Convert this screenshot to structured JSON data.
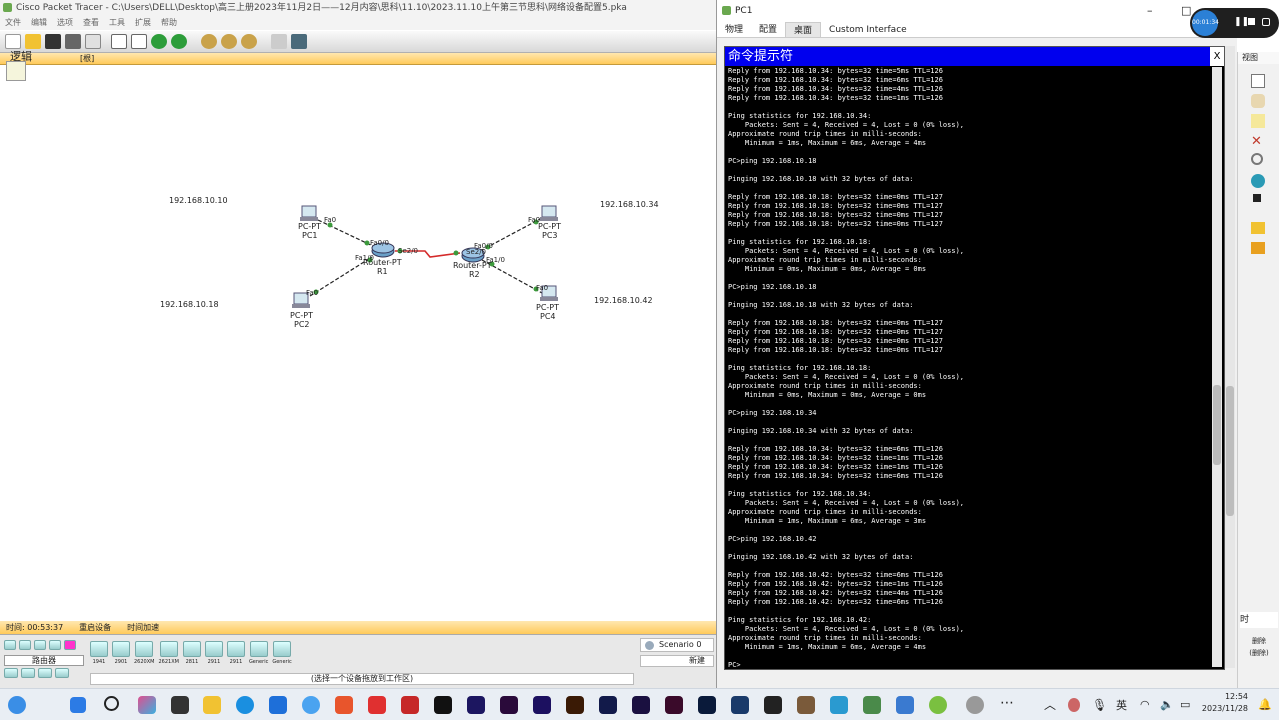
{
  "pt": {
    "title": "Cisco Packet Tracer - C:\\Users\\DELL\\Desktop\\高三上册2023年11月2日——12月内容\\思科\\11.10\\2023.11.10上午第三节思科\\网络设备配置5.pka",
    "menu": [
      "文件",
      "编辑",
      "选项",
      "查看",
      "工具",
      "扩展",
      "帮助"
    ],
    "ws_label": "逻辑",
    "ws_root": "[根]",
    "ip_labels": [
      "192.168.10.10",
      "192.168.10.18",
      "192.168.10.34",
      "192.168.10.42"
    ],
    "devices": [
      {
        "type": "PC-PT",
        "name": "PC1",
        "port": "Fa0"
      },
      {
        "type": "PC-PT",
        "name": "PC2",
        "port": "Fa0"
      },
      {
        "type": "PC-PT",
        "name": "PC3",
        "port": "Fa0"
      },
      {
        "type": "PC-PT",
        "name": "PC4",
        "port": "Fa0"
      },
      {
        "type": "Router-PT",
        "name": "R1"
      },
      {
        "type": "Router-PT",
        "name": "R2"
      }
    ],
    "r1_ports": [
      "Fa0/0",
      "Fa1/0",
      "Se2/0"
    ],
    "r2_ports": [
      "Fa0/0",
      "Fa1/0",
      "Se2/0"
    ],
    "status": {
      "time": "时间: 00:53:37",
      "power": "重启设备",
      "fast": "时间加速"
    },
    "category": "路由器",
    "models": [
      "1941",
      "2901",
      "2620XM",
      "2621XM",
      "2811",
      "2911",
      "2911",
      "Generic",
      "Generic"
    ],
    "hint": "(选择一个设备拖放到工作区)",
    "scenario": "Scenario 0",
    "new_btn": "新建",
    "delete_btn": "删除",
    "delete_btn2": "(删除)"
  },
  "pc1": {
    "title": "PC1",
    "tabs": [
      "物理",
      "配置",
      "桌面",
      "Custom Interface"
    ],
    "active_tab": 2,
    "cmd_title": "命令提示符",
    "close": "X",
    "lines": [
      "Reply from 192.168.10.34: bytes=32 time=5ms TTL=126",
      "Reply from 192.168.10.34: bytes=32 time=6ms TTL=126",
      "Reply from 192.168.10.34: bytes=32 time=4ms TTL=126",
      "Reply from 192.168.10.34: bytes=32 time=1ms TTL=126",
      "",
      "Ping statistics for 192.168.10.34:",
      "    Packets: Sent = 4, Received = 4, Lost = 0 (0% loss),",
      "Approximate round trip times in milli-seconds:",
      "    Minimum = 1ms, Maximum = 6ms, Average = 4ms",
      "",
      "PC>ping 192.168.10.18",
      "",
      "Pinging 192.168.10.18 with 32 bytes of data:",
      "",
      "Reply from 192.168.10.18: bytes=32 time=0ms TTL=127",
      "Reply from 192.168.10.18: bytes=32 time=0ms TTL=127",
      "Reply from 192.168.10.18: bytes=32 time=0ms TTL=127",
      "Reply from 192.168.10.18: bytes=32 time=0ms TTL=127",
      "",
      "Ping statistics for 192.168.10.18:",
      "    Packets: Sent = 4, Received = 4, Lost = 0 (0% loss),",
      "Approximate round trip times in milli-seconds:",
      "    Minimum = 0ms, Maximum = 0ms, Average = 0ms",
      "",
      "PC>ping 192.168.10.18",
      "",
      "Pinging 192.168.10.18 with 32 bytes of data:",
      "",
      "Reply from 192.168.10.18: bytes=32 time=0ms TTL=127",
      "Reply from 192.168.10.18: bytes=32 time=0ms TTL=127",
      "Reply from 192.168.10.18: bytes=32 time=0ms TTL=127",
      "Reply from 192.168.10.18: bytes=32 time=0ms TTL=127",
      "",
      "Ping statistics for 192.168.10.18:",
      "    Packets: Sent = 4, Received = 4, Lost = 0 (0% loss),",
      "Approximate round trip times in milli-seconds:",
      "    Minimum = 0ms, Maximum = 0ms, Average = 0ms",
      "",
      "PC>ping 192.168.10.34",
      "",
      "Pinging 192.168.10.34 with 32 bytes of data:",
      "",
      "Reply from 192.168.10.34: bytes=32 time=6ms TTL=126",
      "Reply from 192.168.10.34: bytes=32 time=1ms TTL=126",
      "Reply from 192.168.10.34: bytes=32 time=1ms TTL=126",
      "Reply from 192.168.10.34: bytes=32 time=6ms TTL=126",
      "",
      "Ping statistics for 192.168.10.34:",
      "    Packets: Sent = 4, Received = 4, Lost = 0 (0% loss),",
      "Approximate round trip times in milli-seconds:",
      "    Minimum = 1ms, Maximum = 6ms, Average = 3ms",
      "",
      "PC>ping 192.168.10.42",
      "",
      "Pinging 192.168.10.42 with 32 bytes of data:",
      "",
      "Reply from 192.168.10.42: bytes=32 time=6ms TTL=126",
      "Reply from 192.168.10.42: bytes=32 time=1ms TTL=126",
      "Reply from 192.168.10.42: bytes=32 time=4ms TTL=126",
      "Reply from 192.168.10.42: bytes=32 time=6ms TTL=126",
      "",
      "Ping statistics for 192.168.10.42:",
      "    Packets: Sent = 4, Received = 4, Lost = 0 (0% loss),",
      "Approximate round trip times in milli-seconds:",
      "    Minimum = 1ms, Maximum = 6ms, Average = 4ms",
      "",
      "PC>"
    ]
  },
  "recorder": {
    "time": "00:01:34"
  },
  "clock": {
    "time": "12:54",
    "date": "2023/11/28"
  },
  "tray": {
    "ime": "英"
  },
  "colors": {
    "cmd_title_bg": "#0000ee",
    "serial_link": "#d42a2a",
    "status_bar": "#ffca5a"
  }
}
